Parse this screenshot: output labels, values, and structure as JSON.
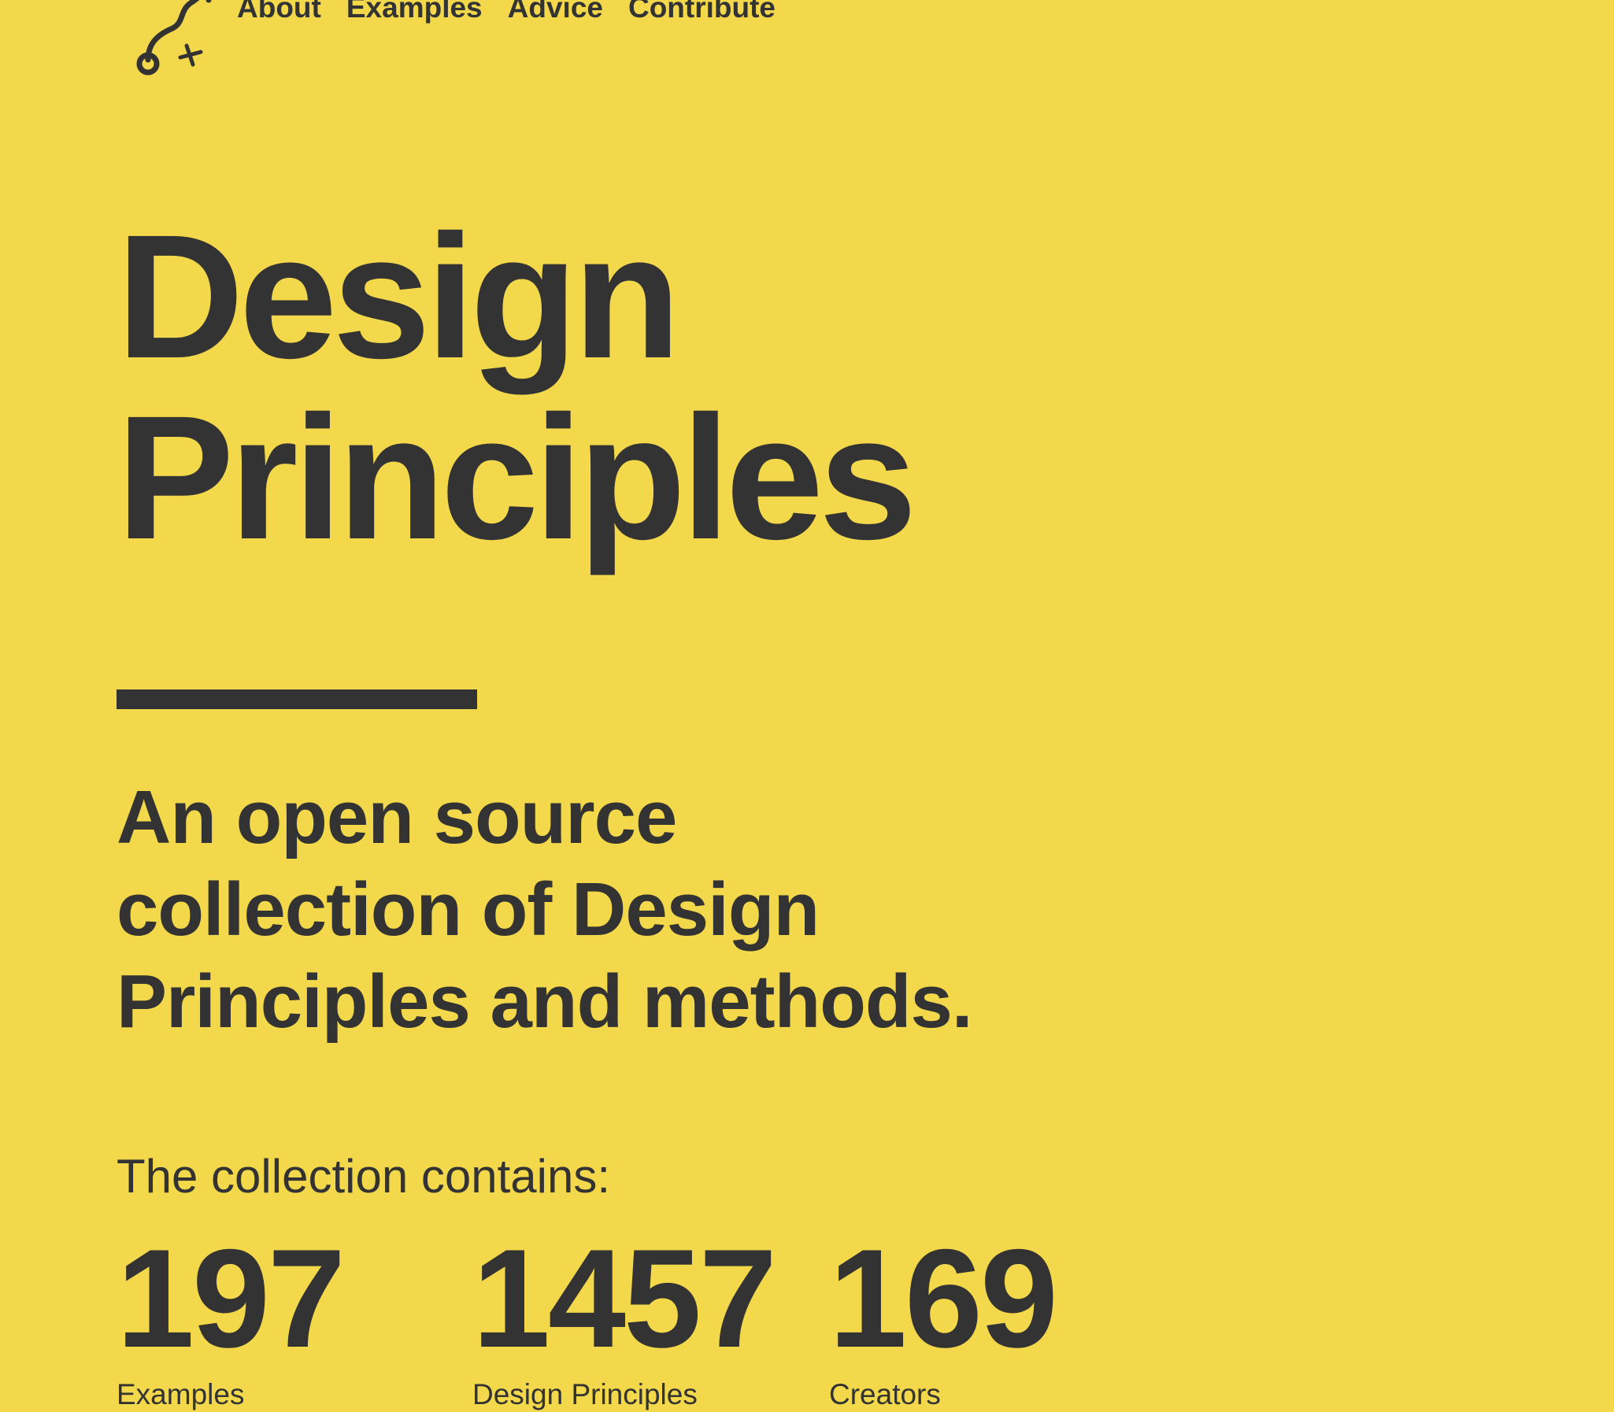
{
  "colors": {
    "background": "#F2D84A",
    "text": "#333333"
  },
  "header": {
    "logo_icon": "play-route-icon",
    "nav": [
      {
        "label": "About"
      },
      {
        "label": "Examples"
      },
      {
        "label": "Advice"
      },
      {
        "label": "Contribute"
      }
    ]
  },
  "hero": {
    "title_line1": "Design",
    "title_line2": "Principles",
    "subtitle_line1": "An open source",
    "subtitle_line2": "collection of Design",
    "subtitle_line3": "Principles and methods."
  },
  "collection": {
    "label": "The collection contains:",
    "stats": [
      {
        "value": "197",
        "label": "Examples"
      },
      {
        "value": "1457",
        "label": "Design Principles"
      },
      {
        "value": "169",
        "label": "Creators"
      }
    ]
  }
}
